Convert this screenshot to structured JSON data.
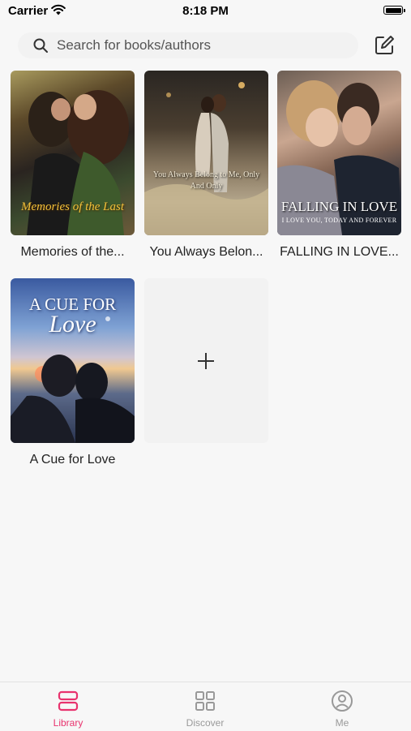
{
  "status_bar": {
    "carrier": "Carrier",
    "time": "8:18 PM"
  },
  "search": {
    "placeholder": "Search for books/authors"
  },
  "books": [
    {
      "title": "Memories of the...",
      "cover_text": "Memories of the Last",
      "cover_subtitle": ""
    },
    {
      "title": "You Always Belon...",
      "cover_text": "You Always Belong to Me, Only And Only",
      "cover_subtitle": ""
    },
    {
      "title": "FALLING IN LOVE...",
      "cover_text": "FALLING IN LOVE",
      "cover_subtitle": "I LOVE YOU, TODAY AND FOREVER"
    },
    {
      "title": "A Cue for Love",
      "cover_text": "A CUE FOR",
      "cover_subtitle": "Love"
    }
  ],
  "add_tile": {
    "icon": "plus-icon"
  },
  "tab_bar": {
    "tabs": [
      {
        "label": "Library",
        "icon": "library-icon",
        "active": true
      },
      {
        "label": "Discover",
        "icon": "grid-icon",
        "active": false
      },
      {
        "label": "Me",
        "icon": "profile-icon",
        "active": false
      }
    ]
  },
  "colors": {
    "accent": "#e8336e",
    "inactive": "#999999",
    "background": "#f7f7f7"
  }
}
